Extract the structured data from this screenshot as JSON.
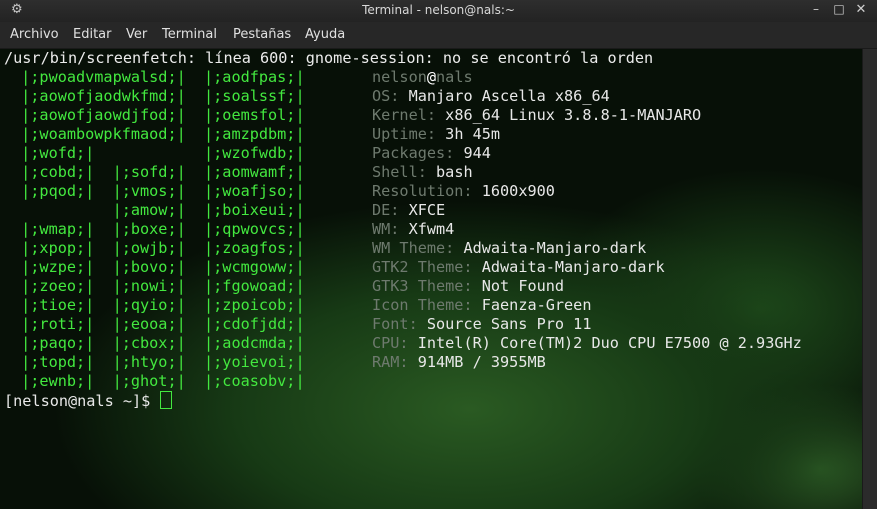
{
  "window": {
    "title": "Terminal - nelson@nals:~",
    "gear_icon": "gear-icon",
    "controls": {
      "minimize": "–",
      "maximize": "□",
      "close": "✕"
    }
  },
  "menubar": {
    "items": [
      "Archivo",
      "Editar",
      "Ver",
      "Terminal",
      "Pestañas",
      "Ayuda"
    ]
  },
  "terminal": {
    "error_line": "/usr/bin/screenfetch: línea 600: gnome-session: no se encontró la orden",
    "logo_lines": [
      " |;pwoadvmapwalsd;|  |;aodfpas;|",
      " |;aowofjaodwkfmd;|  |;soalssf;|",
      " |;aowofjaowdjfod;|  |;oemsfol;|",
      " |;woambowpkfmaod;|  |;amzpdbm;|",
      " |;wofd;|            |;wzofwdb;|",
      " |;cobd;|  |;sofd;|  |;aomwamf;|",
      " |;pqod;|  |;vmos;|  |;woafjso;|",
      "           |;amow;|  |;boixeui;|",
      " |;wmap;|  |;boxe;|  |;qpwovcs;|",
      " |;xpop;|  |;owjb;|  |;zoagfos;|",
      " |;wzpe;|  |;bovo;|  |;wcmgoww;|",
      " |;zoeo;|  |;nowi;|  |;fgowoad;|",
      " |;tioe;|  |;qyio;|  |;zpoicob;|",
      " |;roti;|  |;eooa;|  |;cdofjdd;|",
      " |;paqo;|  |;cbox;|  |;aodcmda;|",
      " |;topd;|  |;htyo;|  |;yoievoi;|",
      " |;ewnb;|  |;ghot;|  |;coasobv;|"
    ],
    "user": "nelson",
    "at": "@",
    "host": "nals",
    "info": [
      {
        "key": "OS:",
        "value": "Manjaro Ascella x86_64"
      },
      {
        "key": "Kernel:",
        "value": "x86_64 Linux 3.8.8-1-MANJARO"
      },
      {
        "key": "Uptime:",
        "value": "3h 45m"
      },
      {
        "key": "Packages:",
        "value": "944"
      },
      {
        "key": "Shell:",
        "value": "bash"
      },
      {
        "key": "Resolution:",
        "value": "1600x900"
      },
      {
        "key": "DE:",
        "value": "XFCE"
      },
      {
        "key": "WM:",
        "value": "Xfwm4"
      },
      {
        "key": "WM Theme:",
        "value": "Adwaita-Manjaro-dark"
      },
      {
        "key": "GTK2 Theme:",
        "value": "Adwaita-Manjaro-dark"
      },
      {
        "key": "GTK3 Theme:",
        "value": "Not Found"
      },
      {
        "key": "Icon Theme:",
        "value": "Faenza-Green"
      },
      {
        "key": "Font:",
        "value": "Source Sans Pro 11"
      },
      {
        "key": "CPU:",
        "value": "Intel(R) Core(TM)2 Duo CPU E7500 @ 2.93GHz"
      },
      {
        "key": "RAM:",
        "value": "914MB / 3955MB"
      }
    ],
    "prompt": "[nelson@nals ~]$ "
  },
  "colors": {
    "logo_green": "#43e83f",
    "key_gray": "#6e7a6e",
    "text": "#e8e8e8",
    "background": "#071007"
  }
}
